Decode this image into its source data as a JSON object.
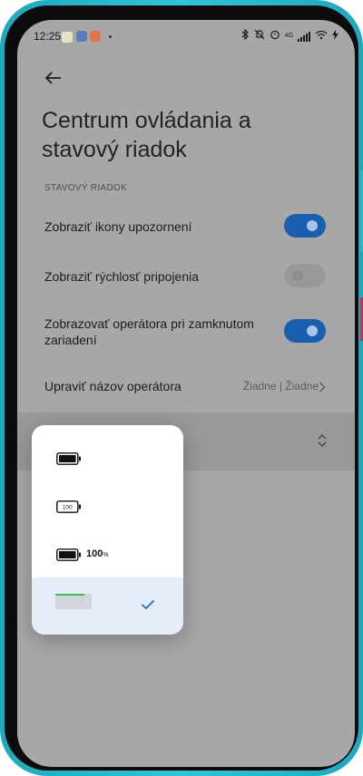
{
  "status_bar": {
    "time": "12:25",
    "network": "4G"
  },
  "header": {
    "back_icon": "arrow-left-icon",
    "title_line1": "Centrum ovládania a",
    "title_line2": "stavový riadok"
  },
  "section": {
    "label": "STAVOVÝ RIADOK"
  },
  "settings": {
    "show_notification_icons": {
      "label": "Zobraziť ikony upozornení",
      "enabled": true
    },
    "show_connection_speed": {
      "label": "Zobraziť rýchlosť pripojenia",
      "enabled": false
    },
    "show_carrier_locked": {
      "label_line1": "Zobrazovať operátora pri zamknutom",
      "label_line2": "zariadení",
      "enabled": true
    },
    "edit_carrier_name": {
      "label": "Upraviť názov operátora",
      "value": "Žiadne | Žiadne"
    }
  },
  "battery_popup": {
    "options": [
      {
        "style": "icon"
      },
      {
        "style": "icon-with-number",
        "icon_text": "100"
      },
      {
        "style": "icon-with-percent",
        "text": "100",
        "unit": "%"
      },
      {
        "style": "top-bar",
        "selected": true
      }
    ]
  },
  "colors": {
    "accent": "#1a5eb0",
    "frame": "#2fc4d6",
    "selected_bg": "#e4edf8",
    "bar_green": "#3ac24c"
  }
}
